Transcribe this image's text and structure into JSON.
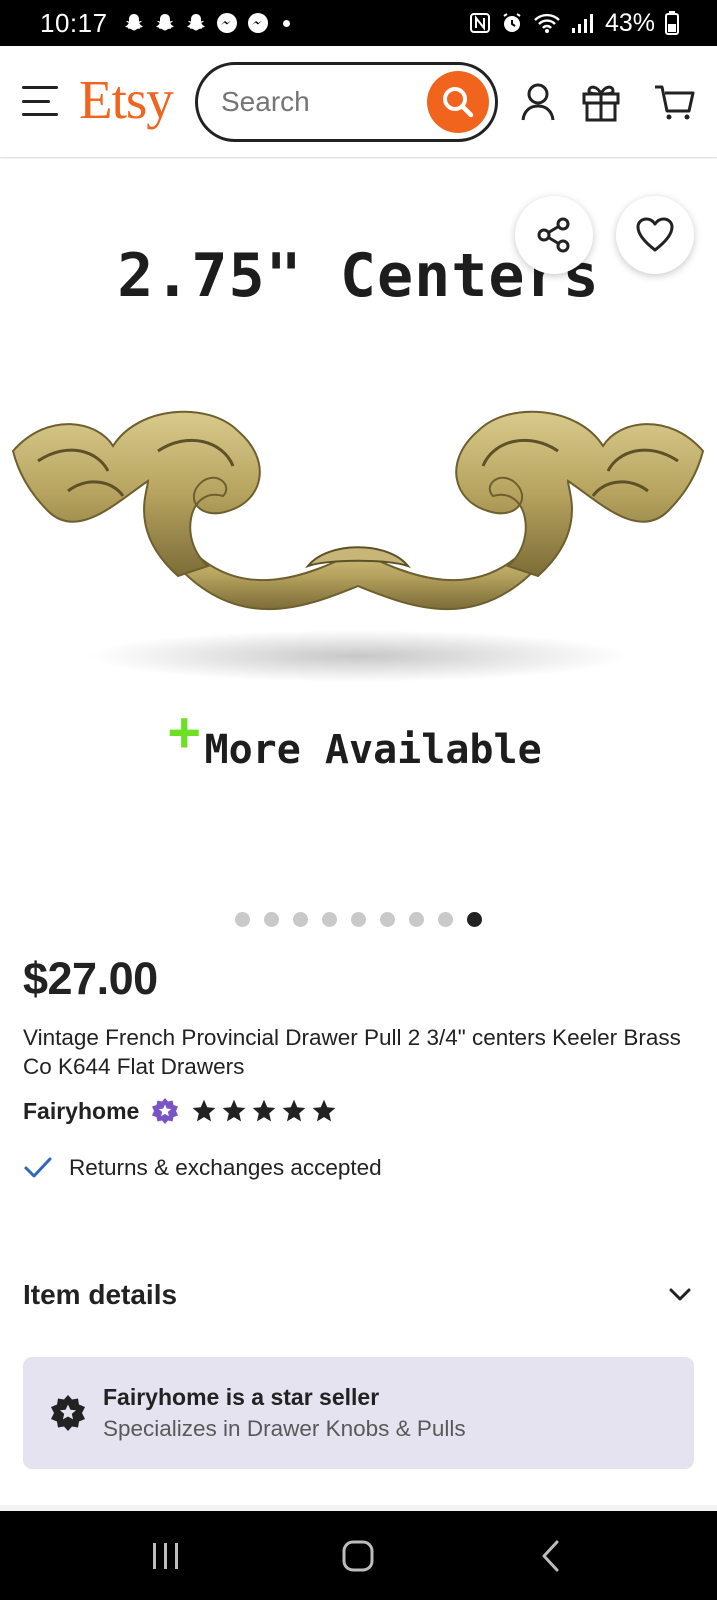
{
  "status_bar": {
    "time": "10:17",
    "battery": "43%",
    "notification_icons": [
      "snapchat-icon",
      "snapchat-icon",
      "snapchat-icon",
      "messenger-icon",
      "messenger-icon"
    ]
  },
  "header": {
    "logo": "Etsy",
    "search": {
      "placeholder": "Search",
      "value": ""
    },
    "accent_color": "#F1641E"
  },
  "listing_image": {
    "caption_top": "2.75\" Centers",
    "caption_bottom": "More Available",
    "image_count": 9,
    "active_index": 8
  },
  "listing": {
    "price": "$27.00",
    "title": "Vintage French Provincial Drawer Pull 2 3/4\" centers Keeler Brass Co K644 Flat Drawers",
    "seller": "Fairyhome",
    "rating_stars": 5,
    "returns": "Returns & exchanges accepted"
  },
  "item_details": {
    "label": "Item details"
  },
  "star_seller": {
    "title": "Fairyhome is a star seller",
    "subtitle": "Specializes in Drawer Knobs & Pulls",
    "background": "#E6E3F1",
    "badge_color": "#7A53C4"
  }
}
